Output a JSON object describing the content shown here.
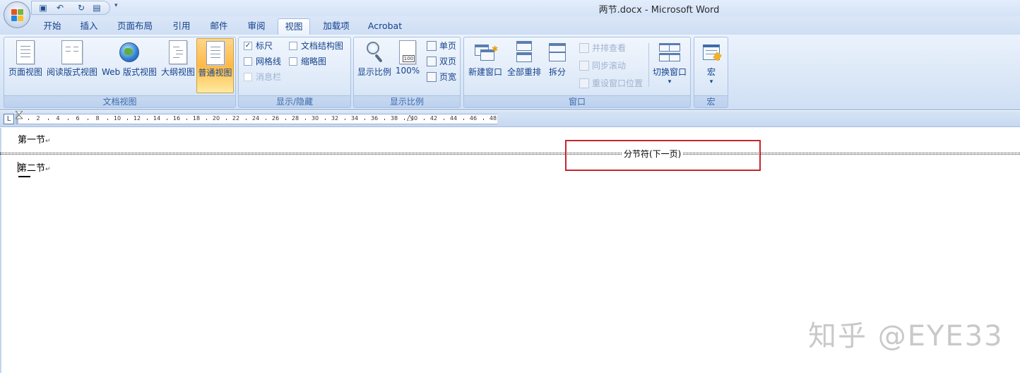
{
  "window": {
    "title": "两节.docx - Microsoft Word"
  },
  "qat": {
    "icons": [
      "save-icon",
      "undo-icon",
      "redo-icon",
      "print-preview-icon"
    ],
    "more": "▾"
  },
  "tabs": [
    "开始",
    "插入",
    "页面布局",
    "引用",
    "邮件",
    "审阅",
    "视图",
    "加载项",
    "Acrobat"
  ],
  "active_tab": "视图",
  "ribbon": {
    "doc_views": {
      "label": "文档视图",
      "buttons": [
        "页面视图",
        "阅读版式视图",
        "Web 版式视图",
        "大纲视图",
        "普通视图"
      ],
      "pressed": "普通视图"
    },
    "show_hide": {
      "label": "显示/隐藏",
      "ruler": {
        "label": "标尺",
        "checked": true
      },
      "gridlines": {
        "label": "网格线",
        "checked": false
      },
      "message_bar": {
        "label": "消息栏",
        "checked": false
      },
      "doc_map": {
        "label": "文档结构图",
        "checked": false
      },
      "thumbnails": {
        "label": "缩略图",
        "checked": false
      }
    },
    "zoom": {
      "label": "显示比例",
      "zoom_btn": "显示比例",
      "hundred_btn": "100%",
      "one_page": "单页",
      "two_pages": "双页",
      "page_width": "页宽"
    },
    "window_grp": {
      "label": "窗口",
      "new_window": "新建窗口",
      "arrange_all": "全部重排",
      "split": "拆分",
      "side_by_side": "并排查看",
      "sync_scroll": "同步滚动",
      "reset_position": "重设窗口位置",
      "switch_windows": "切换窗口",
      "dropdown": "▾"
    },
    "macros": {
      "label": "宏",
      "button": "宏",
      "dropdown": "▾"
    }
  },
  "ruler": {
    "tab_selector": "L",
    "ticks": [
      "2",
      "4",
      "6",
      "8",
      "10",
      "12",
      "14",
      "16",
      "18",
      "20",
      "22",
      "24",
      "26",
      "28",
      "30",
      "32",
      "34",
      "36",
      "38",
      "40",
      "42",
      "44",
      "46",
      "48"
    ]
  },
  "document": {
    "para1": "第一节",
    "para2": "第二节",
    "para_mark": "↵",
    "section_break": "分节符(下一页)"
  },
  "watermark": "知乎 @EYE33"
}
